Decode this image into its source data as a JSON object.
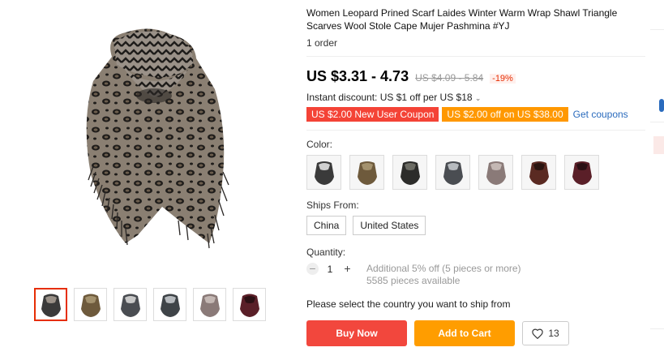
{
  "product": {
    "title": "Women Leopard Prined Scarf Laides Winter Warm Wrap Shawl Triangle Scarves Wool Stole Cape Mujer Pashmina #YJ",
    "orders": "1 order"
  },
  "price": {
    "current": "US $3.31 - 4.73",
    "original": "US $4.09 - 5.84",
    "discount": "-19%"
  },
  "promo": {
    "instant_discount": "Instant discount: US $1 off per US $18",
    "chevron_icon": "chevron-down-icon",
    "coupon_new_user": "US $2.00 New User Coupon",
    "coupon_store": "US $2.00 off on US $38.00",
    "get_coupons": "Get coupons",
    "colors": {
      "coupon_red": "#f44336",
      "coupon_orange": "#ff9800",
      "link": "#2a6bbd"
    }
  },
  "color_section": {
    "label": "Color:",
    "swatch_colors": [
      "#3a3a3a",
      "#6e5a3c",
      "#2c2c2a",
      "#4a4d52",
      "#8a7a78",
      "#5a2a22",
      "#5a1f28"
    ]
  },
  "ships_from": {
    "label": "Ships From:",
    "options": [
      "China",
      "United States"
    ]
  },
  "quantity": {
    "label": "Quantity:",
    "value": "1",
    "minus": "−",
    "plus": "+",
    "additional_off": "Additional 5% off (5 pieces or more)",
    "available": "5585 pieces available"
  },
  "shipping_note": "Please select the country you want to ship from",
  "actions": {
    "buy_now": "Buy Now",
    "add_to_cart": "Add to Cart",
    "wishlist_count": "13",
    "wishlist_icon": "heart-icon",
    "colors": {
      "buy": "#f2473d",
      "cart": "#ff9d00"
    }
  },
  "gallery": {
    "thumb_colors": [
      "#3a3a3a",
      "#6e5a3c",
      "#4a4d52",
      "#3f4448",
      "#8a7a78",
      "#5a1f28"
    ]
  }
}
